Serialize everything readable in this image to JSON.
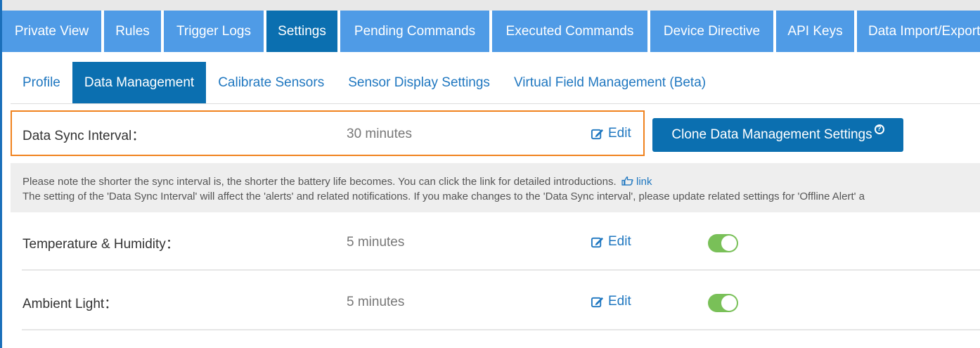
{
  "main_tabs": [
    {
      "label": "Private View",
      "active": false
    },
    {
      "label": "Rules",
      "active": false
    },
    {
      "label": "Trigger Logs",
      "active": false
    },
    {
      "label": "Settings",
      "active": true
    },
    {
      "label": "Pending Commands",
      "active": false
    },
    {
      "label": "Executed Commands",
      "active": false
    },
    {
      "label": "Device Directive",
      "active": false
    },
    {
      "label": "API Keys",
      "active": false
    },
    {
      "label": "Data Import/Export",
      "active": false
    }
  ],
  "sub_tabs": [
    {
      "label": "Profile",
      "active": false
    },
    {
      "label": "Data Management",
      "active": true
    },
    {
      "label": "Calibrate Sensors",
      "active": false
    },
    {
      "label": "Sensor Display Settings",
      "active": false
    },
    {
      "label": "Virtual Field Management (Beta)",
      "active": false
    }
  ],
  "sync": {
    "label": "Data Sync Interval：",
    "value": "30 minutes",
    "edit_label": "Edit"
  },
  "clone_button": {
    "label": "Clone Data Management Settings",
    "help_symbol": "?"
  },
  "note": {
    "line1": "Please note the shorter the sync interval is, the shorter the battery life becomes. You can click the link for detailed introductions.",
    "link_label": "link",
    "line2": "The setting of the 'Data Sync Interval' will affect the 'alerts' and related notifications. If you make changes to the 'Data Sync interval', please update related settings for 'Offline Alert' a"
  },
  "sensors": [
    {
      "label": "Temperature & Humidity：",
      "value": "5 minutes",
      "edit_label": "Edit",
      "enabled": true
    },
    {
      "label": "Ambient Light：",
      "value": "5 minutes",
      "edit_label": "Edit",
      "enabled": true
    }
  ],
  "colors": {
    "tab_bg": "#4f9be6",
    "tab_active_bg": "#0b6fb0",
    "link": "#1f77c0",
    "highlight_border": "#f0821e",
    "toggle_on": "#79c058"
  }
}
